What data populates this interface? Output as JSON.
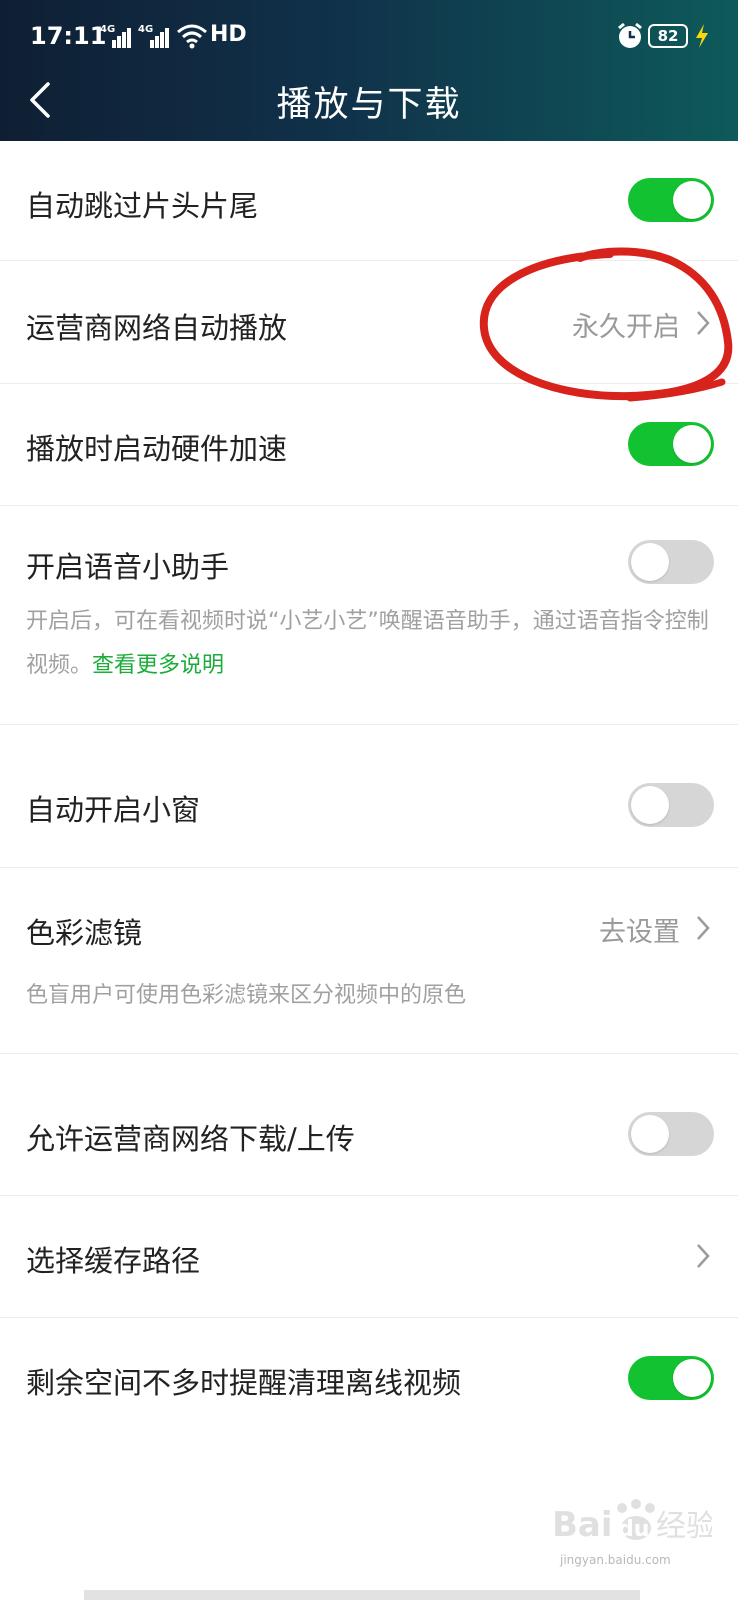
{
  "status_bar": {
    "time": "17:11",
    "signal_1": "4G",
    "signal_2": "4G",
    "network_label": "HD",
    "battery": "82"
  },
  "header": {
    "title": "播放与下载"
  },
  "settings": [
    {
      "label": "自动跳过片头片尾",
      "toggle": true
    },
    {
      "label": "运营商网络自动播放",
      "value": "永久开启"
    },
    {
      "label": "播放时启动硬件加速",
      "toggle": true
    },
    {
      "label": "开启语音小助手",
      "toggle": false,
      "description": "开启后，可在看视频时说“小艺小艺”唤醒语音助手，通过语音指令控制视频。",
      "link": "查看更多说明"
    },
    {
      "label": "自动开启小窗",
      "toggle": false
    },
    {
      "label": "色彩滤镜",
      "value": "去设置",
      "description": "色盲用户可使用色彩滤镜来区分视频中的原色"
    },
    {
      "label": "允许运营商网络下载/上传",
      "toggle": false
    },
    {
      "label": "选择缓存路径"
    },
    {
      "label": "剩余空间不多时提醒清理离线视频",
      "toggle": true
    }
  ],
  "watermark": {
    "brand": "Bai",
    "brand_suffix": "du",
    "cn": "经验",
    "url": "jingyan.baidu.com"
  },
  "colors": {
    "toggle_on": "#13c230",
    "toggle_off": "#d6d6d6",
    "link": "#1aae39",
    "annotation": "#d8231c"
  }
}
